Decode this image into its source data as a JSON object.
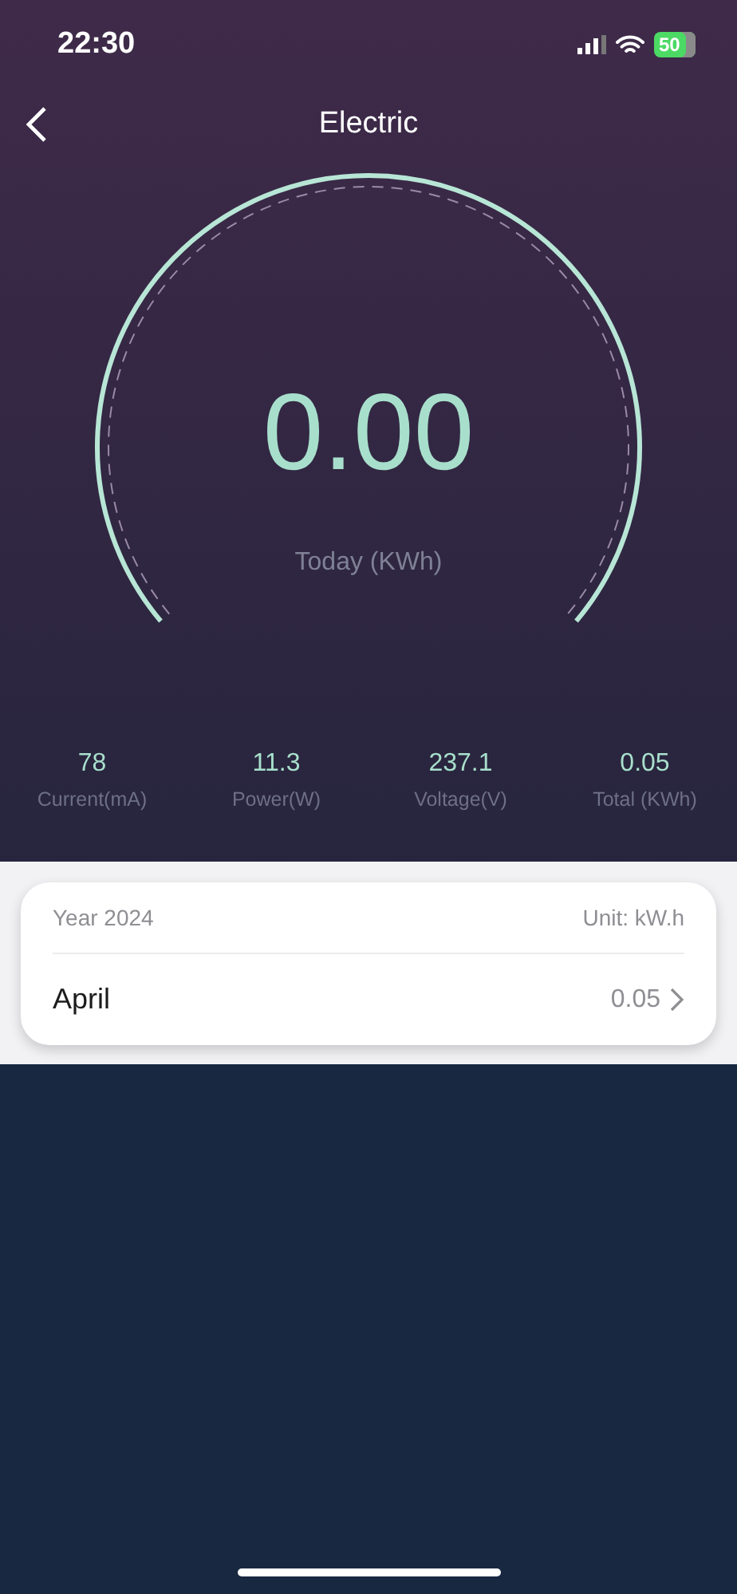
{
  "status_bar": {
    "time": "22:30",
    "battery": "50"
  },
  "header": {
    "title": "Electric"
  },
  "gauge": {
    "value": "0.00",
    "label": "Today (KWh)"
  },
  "stats": [
    {
      "value": "78",
      "label": "Current(mA)"
    },
    {
      "value": "11.3",
      "label": "Power(W)"
    },
    {
      "value": "237.1",
      "label": "Voltage(V)"
    },
    {
      "value": "0.05",
      "label": "Total (KWh)"
    }
  ],
  "year_card": {
    "year": "Year 2024",
    "unit": "Unit: kW.h",
    "rows": [
      {
        "month": "April",
        "value": "0.05"
      }
    ]
  }
}
